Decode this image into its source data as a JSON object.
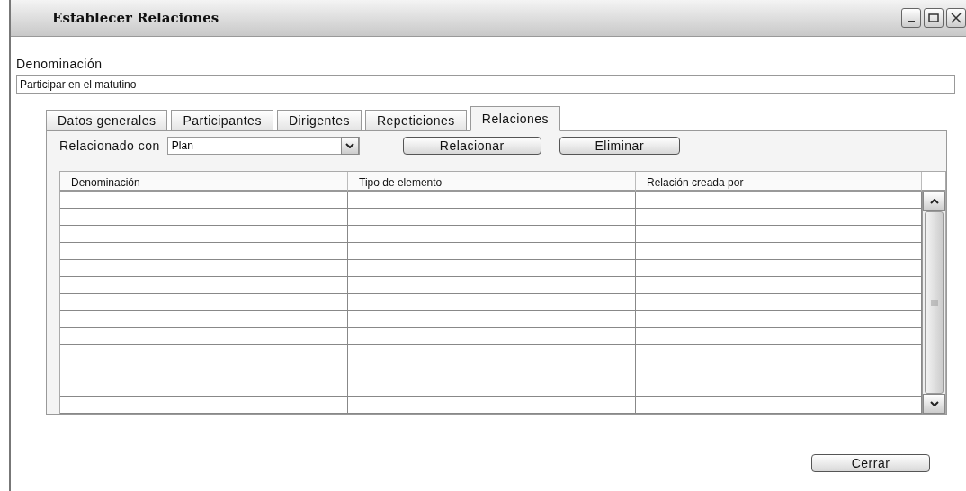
{
  "window": {
    "title": "Establecer Relaciones"
  },
  "denominacion": {
    "label": "Denominación",
    "value": "Participar en el matutino"
  },
  "tabs": [
    {
      "label": "Datos generales",
      "selected": false
    },
    {
      "label": "Participantes",
      "selected": false
    },
    {
      "label": "Dirigentes",
      "selected": false
    },
    {
      "label": "Repeticiones",
      "selected": false
    },
    {
      "label": "Relaciones",
      "selected": true
    }
  ],
  "relacionado": {
    "label": "Relacionado con",
    "value": "Plan"
  },
  "buttons": [
    "Relacionar",
    "Eliminar"
  ],
  "table": {
    "columns": [
      "Denominación",
      "Tipo de elemento",
      "Relación creada por"
    ]
  },
  "footer_button": "Cerrar"
}
